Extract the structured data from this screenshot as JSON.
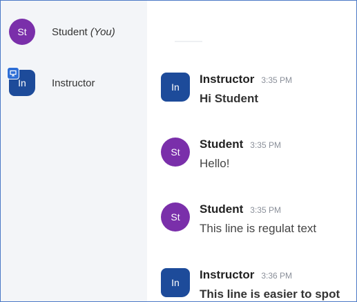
{
  "participants": [
    {
      "initials": "St",
      "name": "Student",
      "suffix": "(You)",
      "role": "student"
    },
    {
      "initials": "In",
      "name": "Instructor",
      "suffix": "",
      "role": "instructor"
    }
  ],
  "messages": [
    {
      "initials": "In",
      "sender": "Instructor",
      "time": "3:35 PM",
      "text": "Hi Student",
      "bold": true
    },
    {
      "initials": "St",
      "sender": "Student",
      "time": "3:35 PM",
      "text": "Hello!",
      "bold": false
    },
    {
      "initials": "St",
      "sender": "Student",
      "time": "3:35 PM",
      "text": "This line is regulat text",
      "bold": false
    },
    {
      "initials": "In",
      "sender": "Instructor",
      "time": "3:36 PM",
      "text": "This line is easier to spot",
      "bold": true
    }
  ],
  "colors": {
    "student": "#7a2faa",
    "instructor": "#1d4b9a",
    "presenter_badge": "#2f6fd6"
  },
  "icons": {
    "presenter": "presenter-screen-icon"
  }
}
